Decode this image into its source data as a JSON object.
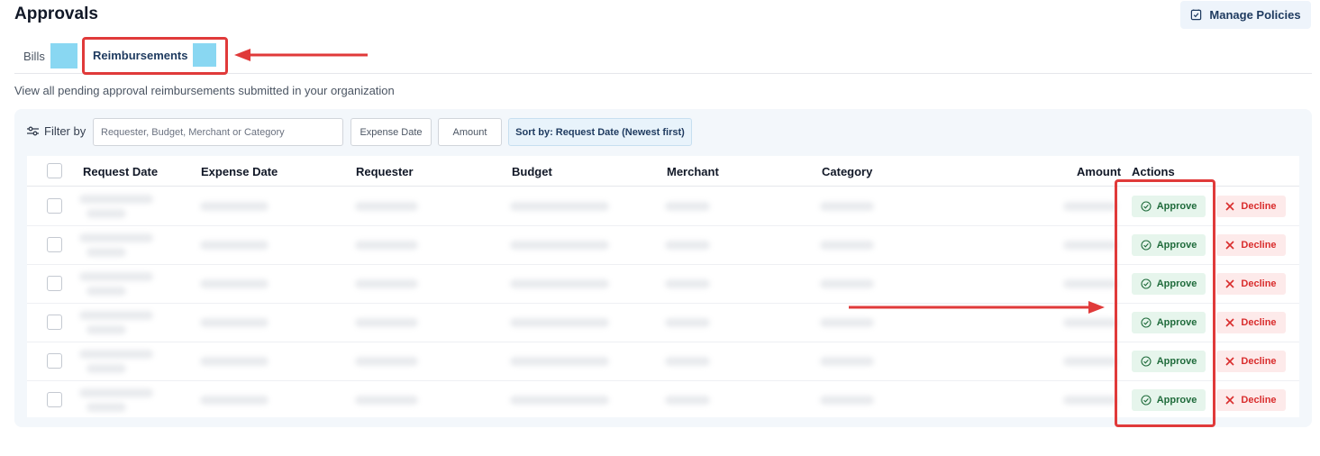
{
  "header": {
    "title": "Approvals",
    "manage_policies_label": "Manage Policies",
    "manage_policies_icon": "document-check-icon"
  },
  "tabs": [
    {
      "label": "Bills",
      "active": false
    },
    {
      "label": "Reimbursements",
      "active": true
    }
  ],
  "subtitle": "View all pending approval reimbursements submitted in your organization",
  "filters": {
    "label": "Filter by",
    "icon": "sliders-icon",
    "search_placeholder": "Requester, Budget, Merchant or Category",
    "expense_date_label": "Expense Date",
    "amount_label": "Amount",
    "sort_label": "Sort by: Request Date (Newest first)"
  },
  "table": {
    "columns": [
      "Request Date",
      "Expense Date",
      "Requester",
      "Budget",
      "Merchant",
      "Category",
      "Amount",
      "Actions"
    ],
    "row_count": 6,
    "approve_label": "Approve",
    "decline_label": "Decline"
  },
  "colors": {
    "accent": "#1e3a5f",
    "approve_bg": "#e6f5ec",
    "approve_text": "#1f6b3b",
    "decline_bg": "#fdeaea",
    "decline_text": "#d92d2d",
    "annotation_red": "#e03a3a",
    "tab_badge": "#89d7f2"
  }
}
